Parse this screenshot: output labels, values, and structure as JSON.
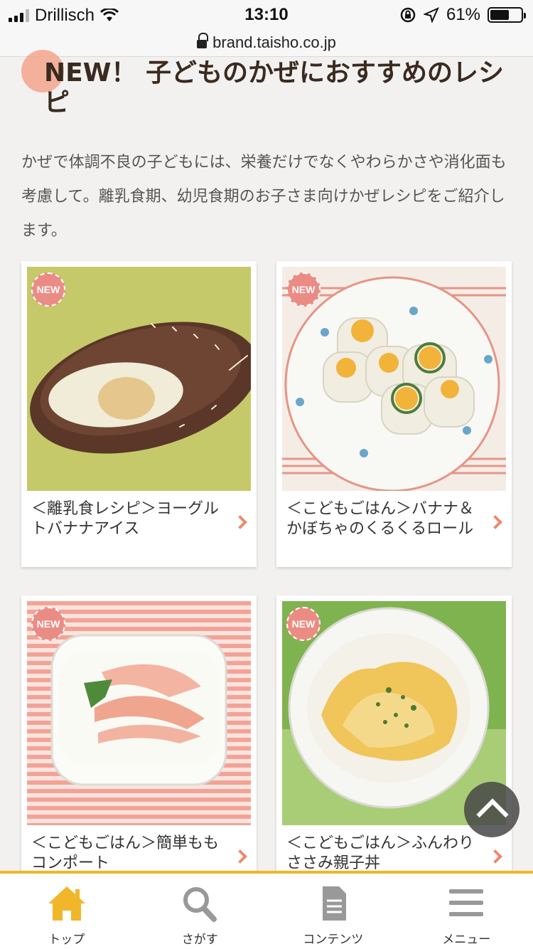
{
  "status_bar": {
    "carrier": "Drillisch",
    "time": "13:10",
    "battery": "61%",
    "battery_level": 0.61
  },
  "url_bar": {
    "url": "brand.taisho.co.jp"
  },
  "section": {
    "title": "NEW！ 子どものかぜにおすすめのレシピ",
    "intro": "かぜで体調不良の子どもには、栄養だけでなくやわらかさや消化面も考慮して。離乳食期、幼児食期のお子さま向けかぜレシピをご紹介します。"
  },
  "cards": [
    {
      "badge": "NEW",
      "title": "＜離乳食レシピ＞ヨーグルトバナナアイス"
    },
    {
      "badge": "NEW",
      "title": "＜こどもごはん＞バナナ＆かぼちゃのくるくるロール"
    },
    {
      "badge": "NEW",
      "title": "＜こどもごはん＞簡単ももコンポート"
    },
    {
      "badge": "NEW",
      "title": "＜こどもごはん＞ふんわりささみ親子丼"
    }
  ],
  "bottom_nav": [
    {
      "label": "トップ",
      "icon": "home-icon",
      "active": true
    },
    {
      "label": "さがす",
      "icon": "search-icon"
    },
    {
      "label": "コンテンツ",
      "icon": "document-icon"
    },
    {
      "label": "メニュー",
      "icon": "menu-icon"
    }
  ],
  "colors": {
    "accent": "#f2b62a",
    "badge": "#eb8c84",
    "arrow": "#eb8a6e"
  }
}
